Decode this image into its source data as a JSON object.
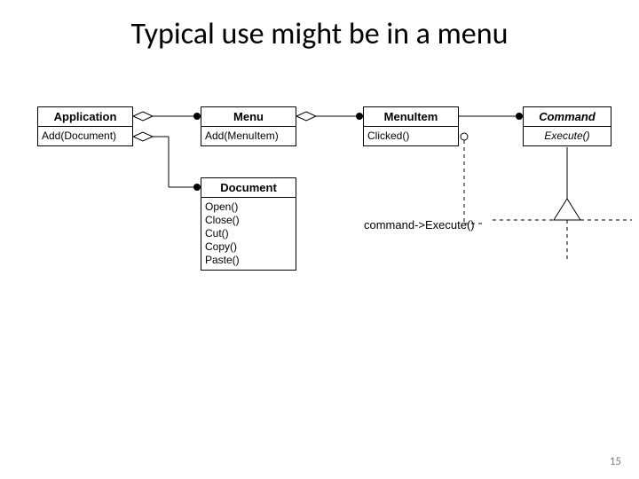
{
  "title": "Typical use might be in a menu",
  "classes": {
    "application": {
      "name": "Application",
      "ops": [
        "Add(Document)"
      ]
    },
    "menu": {
      "name": "Menu",
      "ops": [
        "Add(MenuItem)"
      ]
    },
    "menuitem": {
      "name": "MenuItem",
      "ops": [
        "Clicked()"
      ]
    },
    "command": {
      "name": "Command",
      "ops": [
        "Execute()"
      ]
    },
    "document": {
      "name": "Document",
      "ops": [
        "Open()",
        "Close()",
        "Cut()",
        "Copy()",
        "Paste()"
      ]
    }
  },
  "note": "command->Execute()",
  "page_number": "15"
}
